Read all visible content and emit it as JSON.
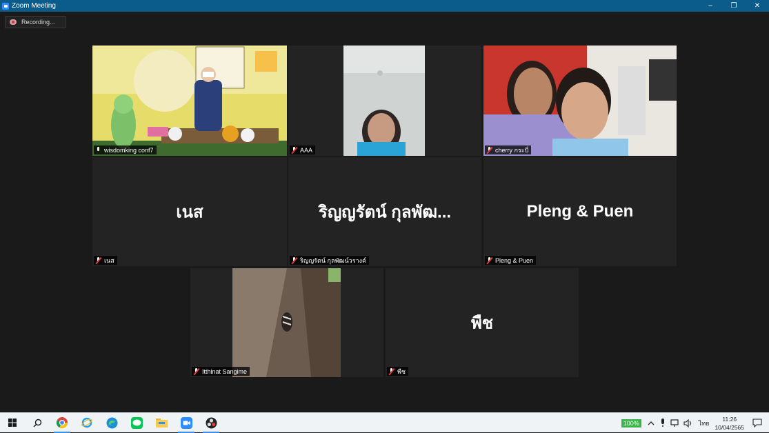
{
  "window": {
    "title": "Zoom Meeting",
    "minimize": "–",
    "restore": "❐",
    "close": "✕"
  },
  "recording": {
    "label": "Recording..."
  },
  "participants": [
    {
      "name": "wisdomking conf7",
      "display": ""
    },
    {
      "name": "AAA",
      "display": ""
    },
    {
      "name": "cherry กระบี่",
      "display": ""
    },
    {
      "name": "เนส",
      "display": "เนส"
    },
    {
      "name": "ริญญรัตน์ กุลพัฒน์วรางค์",
      "display": "ริญญรัตน์ กุลพัฒ..."
    },
    {
      "name": "Pleng & Puen",
      "display": "Pleng & Puen"
    },
    {
      "name": "Itthinat Sangime",
      "display": ""
    },
    {
      "name": "พืช",
      "display": "พืช"
    }
  ],
  "taskbar": {
    "battery": "100%",
    "language": "ไทย",
    "time": "11:26",
    "date": "10/04/2565"
  },
  "colors": {
    "active_speaker": "#e9e860",
    "titlebar": "#0b5c8a",
    "muted": "#e03b3b"
  }
}
